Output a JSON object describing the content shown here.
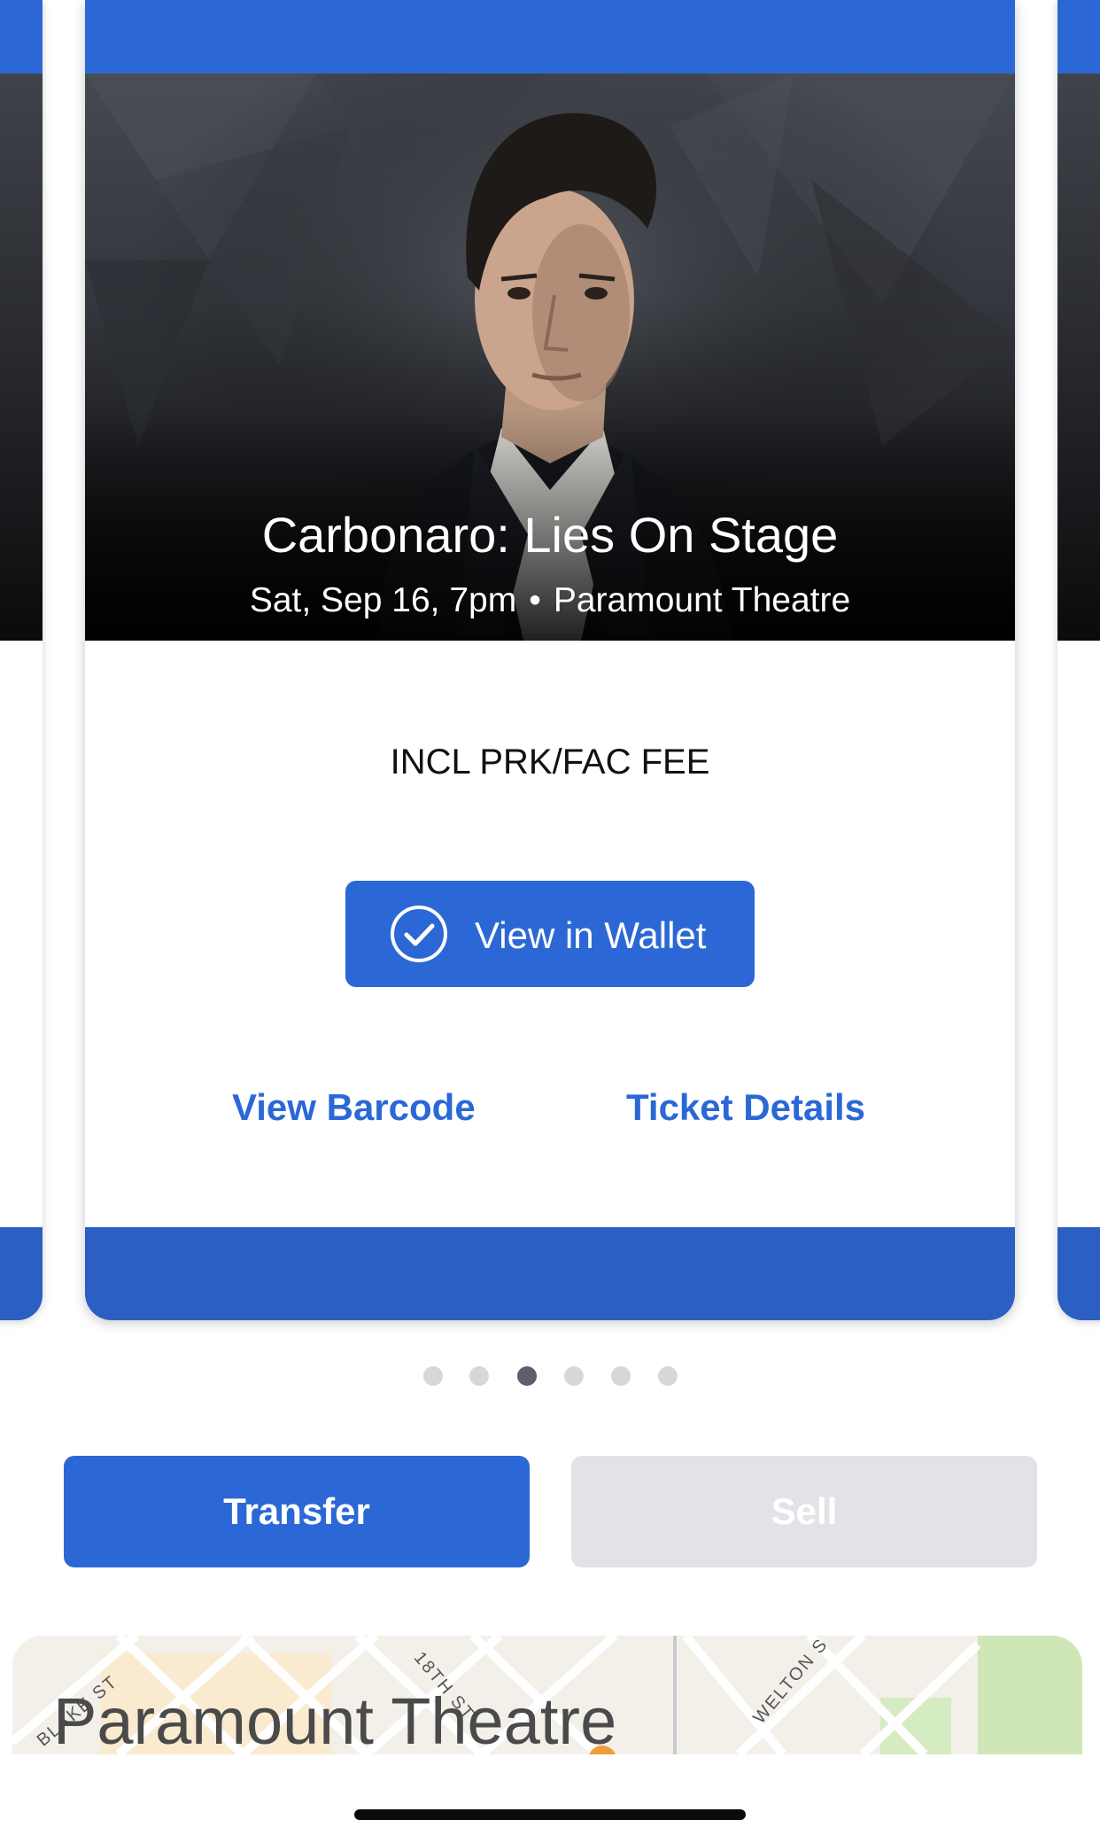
{
  "event": {
    "title": "Carbonaro: Lies On Stage",
    "date_time": "Sat, Sep 16, 7pm",
    "separator": "•",
    "venue": "Paramount Theatre"
  },
  "ticket": {
    "fee_note": "INCL PRK/FAC FEE",
    "wallet_button": "View in Wallet",
    "view_barcode": "View Barcode",
    "ticket_details": "Ticket Details"
  },
  "pagination": {
    "total": 6,
    "active_index": 2
  },
  "actions": {
    "transfer": "Transfer",
    "sell": "Sell"
  },
  "map": {
    "title": "Paramount Theatre",
    "streets": [
      "BLAKE ST",
      "18TH ST",
      "WELTON S"
    ]
  },
  "colors": {
    "accent": "#2b68d6",
    "card_footer": "#2b5fc4",
    "disabled": "#e1e3e6"
  },
  "icons": {
    "wallet": "check-circle-icon",
    "map_pin": "map-pin-icon"
  }
}
